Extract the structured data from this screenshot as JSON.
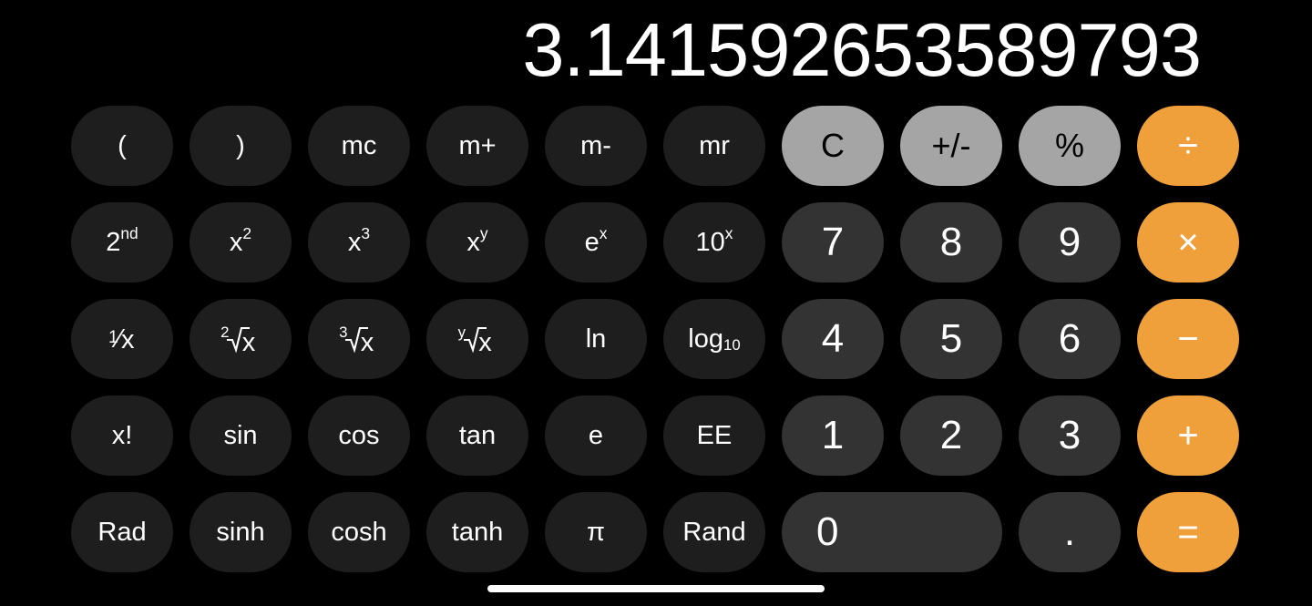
{
  "app": {
    "name": "Calculator",
    "mode": "scientific",
    "background_color": "#000000"
  },
  "display": {
    "value": "3.141592653589793"
  },
  "colors": {
    "background": "#000000",
    "function_key": "#1e1e1e",
    "digit_key": "#333333",
    "top_gray_key": "#a5a5a5",
    "operator_key": "#f0a03a",
    "text_light": "#ffffff",
    "text_dark": "#000000"
  },
  "keypad": {
    "rows": [
      [
        {
          "id": "open-paren",
          "label": "(",
          "style": "fn"
        },
        {
          "id": "close-paren",
          "label": ")",
          "style": "fn"
        },
        {
          "id": "mc",
          "label": "mc",
          "style": "fn"
        },
        {
          "id": "m-plus",
          "label": "m+",
          "style": "fn"
        },
        {
          "id": "m-minus",
          "label": "m-",
          "style": "fn"
        },
        {
          "id": "mr",
          "label": "mr",
          "style": "fn"
        },
        {
          "id": "clear",
          "label": "C",
          "style": "topgray"
        },
        {
          "id": "sign",
          "label": "+/-",
          "style": "topgray"
        },
        {
          "id": "percent",
          "label": "%",
          "style": "topgray"
        },
        {
          "id": "divide",
          "label": "÷",
          "style": "op"
        }
      ],
      [
        {
          "id": "second",
          "label": "2nd",
          "style": "fn"
        },
        {
          "id": "x-squared",
          "label": "x²",
          "style": "fn"
        },
        {
          "id": "x-cubed",
          "label": "x³",
          "style": "fn"
        },
        {
          "id": "x-power-y",
          "label": "xʸ",
          "style": "fn"
        },
        {
          "id": "e-power-x",
          "label": "eˣ",
          "style": "fn"
        },
        {
          "id": "ten-power-x",
          "label": "10ˣ",
          "style": "fn"
        },
        {
          "id": "digit-7",
          "label": "7",
          "style": "digit"
        },
        {
          "id": "digit-8",
          "label": "8",
          "style": "digit"
        },
        {
          "id": "digit-9",
          "label": "9",
          "style": "digit"
        },
        {
          "id": "multiply",
          "label": "×",
          "style": "op"
        }
      ],
      [
        {
          "id": "reciprocal",
          "label": "1/x",
          "style": "fn"
        },
        {
          "id": "square-root",
          "label": "²√x",
          "style": "fn"
        },
        {
          "id": "cube-root",
          "label": "³√x",
          "style": "fn"
        },
        {
          "id": "y-root",
          "label": "ʸ√x",
          "style": "fn"
        },
        {
          "id": "ln",
          "label": "ln",
          "style": "fn"
        },
        {
          "id": "log10",
          "label": "log10",
          "style": "fn"
        },
        {
          "id": "digit-4",
          "label": "4",
          "style": "digit"
        },
        {
          "id": "digit-5",
          "label": "5",
          "style": "digit"
        },
        {
          "id": "digit-6",
          "label": "6",
          "style": "digit"
        },
        {
          "id": "subtract",
          "label": "−",
          "style": "op"
        }
      ],
      [
        {
          "id": "factorial",
          "label": "x!",
          "style": "fn"
        },
        {
          "id": "sin",
          "label": "sin",
          "style": "fn"
        },
        {
          "id": "cos",
          "label": "cos",
          "style": "fn"
        },
        {
          "id": "tan",
          "label": "tan",
          "style": "fn"
        },
        {
          "id": "euler",
          "label": "e",
          "style": "fn"
        },
        {
          "id": "ee",
          "label": "EE",
          "style": "fn"
        },
        {
          "id": "digit-1",
          "label": "1",
          "style": "digit"
        },
        {
          "id": "digit-2",
          "label": "2",
          "style": "digit"
        },
        {
          "id": "digit-3",
          "label": "3",
          "style": "digit"
        },
        {
          "id": "add",
          "label": "+",
          "style": "op"
        }
      ],
      [
        {
          "id": "rad",
          "label": "Rad",
          "style": "fn"
        },
        {
          "id": "sinh",
          "label": "sinh",
          "style": "fn"
        },
        {
          "id": "cosh",
          "label": "cosh",
          "style": "fn"
        },
        {
          "id": "tanh",
          "label": "tanh",
          "style": "fn"
        },
        {
          "id": "pi",
          "label": "π",
          "style": "fn"
        },
        {
          "id": "rand",
          "label": "Rand",
          "style": "fn"
        },
        {
          "id": "digit-0",
          "label": "0",
          "style": "digit wide"
        },
        {
          "id": "decimal",
          "label": ".",
          "style": "digit"
        },
        {
          "id": "equals",
          "label": "=",
          "style": "op"
        }
      ]
    ]
  },
  "parts": {
    "second_base": "2",
    "second_sup": "nd",
    "x_base": "x",
    "sup_2": "2",
    "sup_3": "3",
    "sup_y": "y",
    "sup_x": "x",
    "e_base": "e",
    "ten_base": "10",
    "frac_one": "1",
    "frac_slash": "⁄",
    "frac_x": "x",
    "root_index_2": "2",
    "root_index_3": "3",
    "root_index_y": "y",
    "root_radicand": "x",
    "log_base_text": "log",
    "log_sub": "10"
  },
  "home_indicator": {
    "present": true,
    "color": "#ffffff"
  }
}
